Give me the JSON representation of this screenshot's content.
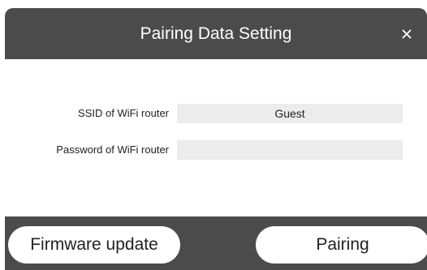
{
  "dialog": {
    "title": "Pairing Data Setting",
    "close_icon": "close-icon"
  },
  "form": {
    "ssid": {
      "label": "SSID of WiFi router",
      "value": "Guest"
    },
    "password": {
      "label": "Password of WiFi router",
      "value": ""
    }
  },
  "footer": {
    "firmware_label": "Firmware update",
    "pairing_label": "Pairing"
  },
  "colors": {
    "header_bg": "#4b4b4b",
    "field_bg": "#ececec",
    "button_bg": "#ffffff"
  }
}
